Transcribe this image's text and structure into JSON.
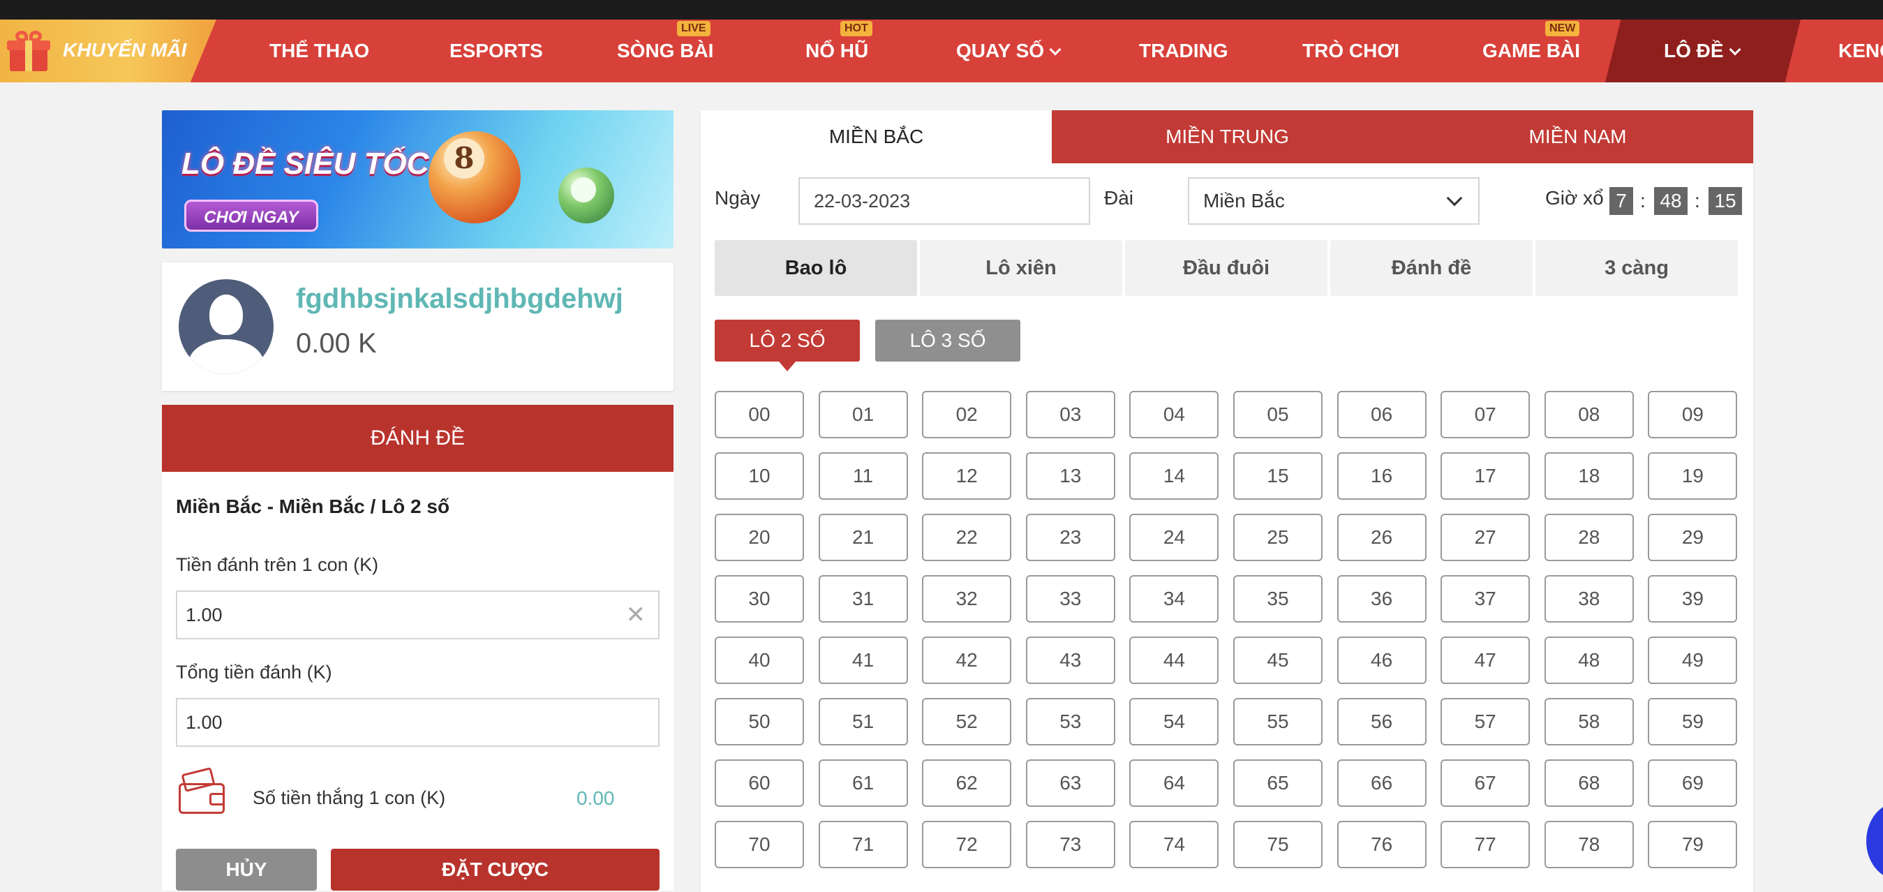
{
  "nav": {
    "promo_label": "KHUYẾN MÃI",
    "items": [
      {
        "label": "THỂ THAO",
        "badge": ""
      },
      {
        "label": "ESPORTS",
        "badge": ""
      },
      {
        "label": "SÒNG BÀI",
        "badge": "LIVE"
      },
      {
        "label": "NỔ HŨ",
        "badge": "HOT"
      },
      {
        "label": "QUAY SỐ",
        "badge": ""
      },
      {
        "label": "TRADING",
        "badge": ""
      },
      {
        "label": "TRÒ CHƠI",
        "badge": ""
      },
      {
        "label": "GAME BÀI",
        "badge": "NEW"
      },
      {
        "label": "LÔ ĐỀ",
        "badge": ""
      },
      {
        "label": "KENO",
        "badge": ""
      }
    ],
    "active_color": "#8f1f1c"
  },
  "banner": {
    "title": "LÔ ĐỀ SIÊU TỐC",
    "cta": "CHƠI NGAY",
    "ball_number": "8"
  },
  "user": {
    "name": "fgdhbsjnkalsdjhbgdehwj",
    "balance": "0.00 K"
  },
  "betform": {
    "header": "ĐÁNH ĐỀ",
    "subtitle": "Miền Bắc - Miền Bắc / Lô 2 số",
    "per_label": "Tiền đánh trên 1 con (K)",
    "per_value": "1.00",
    "total_label": "Tổng tiền đánh (K)",
    "total_value": "1.00",
    "win_label": "Số tiền thắng 1 con (K)",
    "win_value": "0.00",
    "cancel": "HỦY",
    "place": "ĐẶT CƯỢC"
  },
  "panel": {
    "regions": [
      "MIỀN BẮC",
      "MIỀN TRUNG",
      "MIỀN NAM"
    ],
    "date_label": "Ngày",
    "date_value": "22-03-2023",
    "station_label": "Đài",
    "station_value": "Miền Bắc",
    "draw_label": "Giờ xổ",
    "time": {
      "h": "7",
      "m": "48",
      "s": "15"
    },
    "bet_types": [
      "Bao lô",
      "Lô xiên",
      "Đầu đuôi",
      "Đánh đề",
      "3 càng"
    ],
    "sub_types": [
      "LÔ 2 SỐ",
      "LÔ 3 SỐ"
    ],
    "numbers": [
      [
        "00",
        "01",
        "02",
        "03",
        "04",
        "05",
        "06",
        "07",
        "08",
        "09"
      ],
      [
        "10",
        "11",
        "12",
        "13",
        "14",
        "15",
        "16",
        "17",
        "18",
        "19"
      ],
      [
        "20",
        "21",
        "22",
        "23",
        "24",
        "25",
        "26",
        "27",
        "28",
        "29"
      ],
      [
        "30",
        "31",
        "32",
        "33",
        "34",
        "35",
        "36",
        "37",
        "38",
        "39"
      ],
      [
        "40",
        "41",
        "42",
        "43",
        "44",
        "45",
        "46",
        "47",
        "48",
        "49"
      ],
      [
        "50",
        "51",
        "52",
        "53",
        "54",
        "55",
        "56",
        "57",
        "58",
        "59"
      ],
      [
        "60",
        "61",
        "62",
        "63",
        "64",
        "65",
        "66",
        "67",
        "68",
        "69"
      ],
      [
        "70",
        "71",
        "72",
        "73",
        "74",
        "75",
        "76",
        "77",
        "78",
        "79"
      ]
    ]
  }
}
